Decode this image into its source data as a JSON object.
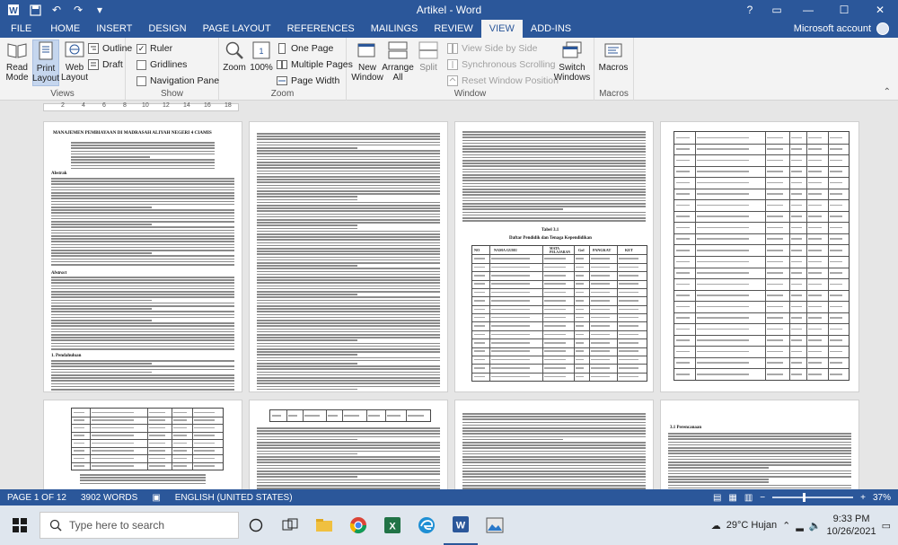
{
  "window": {
    "title": "Artikel - Word"
  },
  "quick_access": {
    "autosave_icon": "save-icon",
    "undo_icon": "undo-icon",
    "redo_icon": "redo-icon"
  },
  "window_controls": {
    "minimize": "—",
    "maximize": "☐",
    "close": "✕"
  },
  "tabs": [
    {
      "label": "FILE"
    },
    {
      "label": "HOME"
    },
    {
      "label": "INSERT"
    },
    {
      "label": "DESIGN"
    },
    {
      "label": "PAGE LAYOUT"
    },
    {
      "label": "REFERENCES"
    },
    {
      "label": "MAILINGS"
    },
    {
      "label": "REVIEW"
    },
    {
      "label": "VIEW"
    },
    {
      "label": "ADD-INS"
    }
  ],
  "account": {
    "name": "Microsoft account"
  },
  "ribbon": {
    "views": {
      "label": "Views",
      "read_mode": "Read Mode",
      "print_layout": "Print Layout",
      "web_layout": "Web Layout",
      "outline": "Outline",
      "draft": "Draft"
    },
    "show": {
      "label": "Show",
      "ruler": "Ruler",
      "gridlines": "Gridlines",
      "navigation_pane": "Navigation Pane",
      "ruler_checked": "✓"
    },
    "zoom": {
      "label": "Zoom",
      "zoom": "Zoom",
      "percent": "100%",
      "one_page": "One Page",
      "multiple_pages": "Multiple Pages",
      "page_width": "Page Width"
    },
    "window": {
      "label": "Window",
      "new_window": "New Window",
      "arrange_all": "Arrange All",
      "split": "Split",
      "view_side_by_side": "View Side by Side",
      "synchronous_scrolling": "Synchronous Scrolling",
      "reset_window_position": "Reset Window Position",
      "switch_windows": "Switch Windows"
    },
    "macros": {
      "label": "Macros",
      "macros": "Macros"
    }
  },
  "ruler_numbers": [
    "2",
    "4",
    "6",
    "8",
    "10",
    "12",
    "14",
    "16",
    "18"
  ],
  "pages": {
    "p1_title": "MANAJEMEN PEMBIAYAAN DI MADRASAH ALIYAH NEGERI 4 CIAMIS",
    "p1_abstrak": "Abstrak",
    "p1_abstract": "Abstract",
    "p1_pendahuluan": "1. Pendahuluan",
    "p3_table_title": "Tabel 3.1",
    "p3_table_caption": "Daftar Pendidik dan Tenaga Kependidikan",
    "p3_headers": [
      "NO",
      "NAMA GURU",
      "MATA PELAJARAN",
      "Gol",
      "PANGKAT",
      "KET"
    ],
    "p7_heading": "3.1 Perencanaan"
  },
  "status": {
    "page": "PAGE 1 OF 12",
    "words": "3902 WORDS",
    "language": "ENGLISH (UNITED STATES)",
    "zoom": "37%"
  },
  "taskbar": {
    "search_placeholder": "Type here to search",
    "weather": "29°C Hujan",
    "time": "9:33 PM",
    "date": "10/26/2021"
  }
}
